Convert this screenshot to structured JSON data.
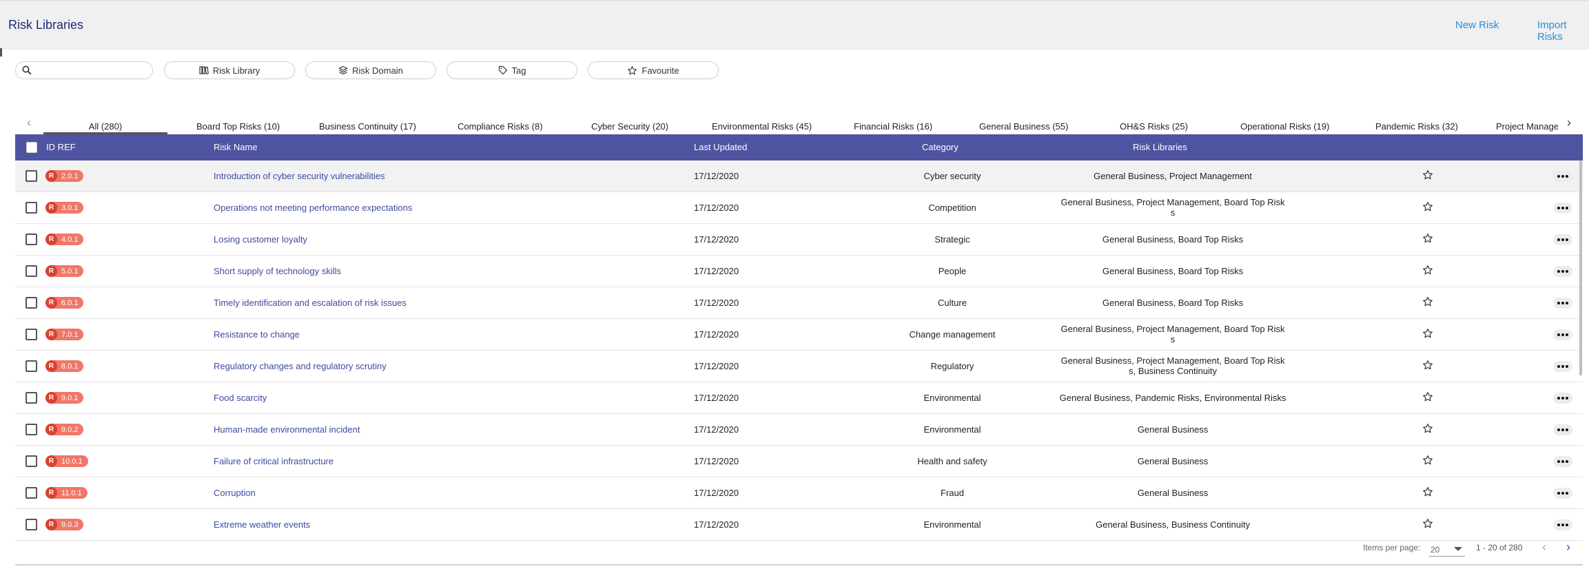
{
  "header": {
    "title": "Risk Libraries",
    "new_risk": "New Risk",
    "import_risks": "Import Risks"
  },
  "filters": {
    "search_placeholder": "",
    "search_value": "",
    "pills": [
      {
        "label": "Risk Library",
        "icon": "library-icon"
      },
      {
        "label": "Risk Domain",
        "icon": "layers-icon"
      },
      {
        "label": "Tag",
        "icon": "tag-icon"
      },
      {
        "label": "Favourite",
        "icon": "star-icon"
      }
    ]
  },
  "tabs": [
    {
      "label": "All (280)",
      "active": true
    },
    {
      "label": "Board Top Risks (10)"
    },
    {
      "label": "Business Continuity (17)"
    },
    {
      "label": "Compliance Risks (8)"
    },
    {
      "label": "Cyber Security (20)"
    },
    {
      "label": "Environmental Risks (45)"
    },
    {
      "label": "Financial Risks (16)"
    },
    {
      "label": "General Business (55)"
    },
    {
      "label": "OH&S Risks (25)"
    },
    {
      "label": "Operational Risks (19)"
    },
    {
      "label": "Pandemic Risks (32)"
    },
    {
      "label": "Project Manage"
    }
  ],
  "table": {
    "headers": {
      "id_ref": "ID REF",
      "risk_name": "Risk Name",
      "last_updated": "Last Updated",
      "category": "Category",
      "risk_libraries": "Risk Libraries"
    },
    "badge_prefix": "R",
    "rows": [
      {
        "id": "2.0.1",
        "name": "Introduction of cyber security vulnerabilities",
        "updated": "17/12/2020",
        "category": "Cyber security",
        "libs": "General Business, Project Management"
      },
      {
        "id": "3.0.1",
        "name": "Operations not meeting performance expectations",
        "updated": "17/12/2020",
        "category": "Competition",
        "libs": "General Business, Project Management, Board Top Risk",
        "libs2": "s"
      },
      {
        "id": "4.0.1",
        "name": "Losing customer loyalty",
        "updated": "17/12/2020",
        "category": "Strategic",
        "libs": "General Business, Board Top Risks"
      },
      {
        "id": "5.0.1",
        "name": "Short supply of technology skills",
        "updated": "17/12/2020",
        "category": "People",
        "libs": "General Business, Board Top Risks"
      },
      {
        "id": "6.0.1",
        "name": "Timely identification and escalation of risk issues",
        "updated": "17/12/2020",
        "category": "Culture",
        "libs": "General Business, Board Top Risks"
      },
      {
        "id": "7.0.1",
        "name": "Resistance to change",
        "updated": "17/12/2020",
        "category": "Change management",
        "libs": "General Business, Project Management, Board Top Risk",
        "libs2": "s"
      },
      {
        "id": "8.0.1",
        "name": "Regulatory changes and regulatory scrutiny",
        "updated": "17/12/2020",
        "category": "Regulatory",
        "libs": "General Business, Project Management, Board Top Risk",
        "libs2": "s, Business Continuity"
      },
      {
        "id": "9.0.1",
        "name": "Food scarcity",
        "updated": "17/12/2020",
        "category": "Environmental",
        "libs": "General Business, Pandemic Risks, Environmental Risks"
      },
      {
        "id": "9.0.2",
        "name": "Human-made environmental incident",
        "updated": "17/12/2020",
        "category": "Environmental",
        "libs": "General Business"
      },
      {
        "id": "10.0.1",
        "name": "Failure of critical infrastructure",
        "updated": "17/12/2020",
        "category": "Health and safety",
        "libs": "General Business"
      },
      {
        "id": "11.0.1",
        "name": "Corruption",
        "updated": "17/12/2020",
        "category": "Fraud",
        "libs": "General Business"
      },
      {
        "id": "9.0.3",
        "name": "Extreme weather events",
        "updated": "17/12/2020",
        "category": "Environmental",
        "libs": "General Business, Business Continuity"
      }
    ]
  },
  "pagination": {
    "items_per_page_label": "Items per page:",
    "items_per_page": "20",
    "range": "1 - 20 of 280"
  },
  "colors": {
    "header_bar": "#4e54a0",
    "link": "#3d4aa0",
    "badge": "#f0776a",
    "badge_dot": "#d9432f",
    "action_link": "#1f8fd6"
  }
}
